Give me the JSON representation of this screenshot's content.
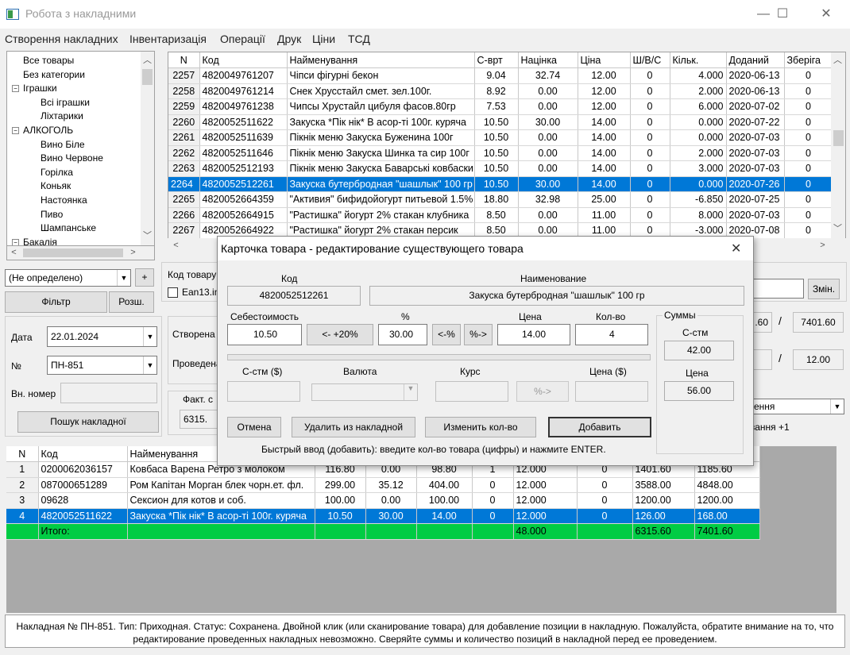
{
  "window": {
    "title": "Робота з накладними",
    "minimize": "—",
    "maximize": "☐",
    "close": "✕"
  },
  "menu": [
    "Створення накладних",
    "Інвентаризація",
    "Операції",
    "Друк",
    "Ціни",
    "ТСД"
  ],
  "tree": [
    {
      "label": "Все товары",
      "level": 0
    },
    {
      "label": "Без категории",
      "level": 0
    },
    {
      "label": "Іграшки",
      "level": 0,
      "expanded": true
    },
    {
      "label": "Всі іграшки",
      "level": 1
    },
    {
      "label": "Ліхтарики",
      "level": 1
    },
    {
      "label": "АЛКОГОЛЬ",
      "level": 0,
      "expanded": true
    },
    {
      "label": "Вино Біле",
      "level": 1
    },
    {
      "label": "Вино Червоне",
      "level": 1
    },
    {
      "label": "Горілка",
      "level": 1
    },
    {
      "label": "Коньяк",
      "level": 1
    },
    {
      "label": "Настоянка",
      "level": 1
    },
    {
      "label": "Пиво",
      "level": 1
    },
    {
      "label": "Шампанське",
      "level": 1
    },
    {
      "label": "Бакалія",
      "level": 0,
      "expanded": true
    }
  ],
  "left_panel": {
    "category_select": "(Не определено)",
    "plus": "+",
    "filter_btn": "Фільтр",
    "expand_btn": "Розш.",
    "date_label": "Дата",
    "date_value": "22.01.2024",
    "no_label": "№",
    "no_value": "ПН-851",
    "ext_no_label": "Вн. номер",
    "ext_no_value": "",
    "search_btn": "Пошук накладної"
  },
  "mid_panel": {
    "code_label": "Код товару",
    "ean_label": "Ean13.in",
    "created_label": "Створена",
    "posted_label": "Проведена",
    "fact_label": "Факт. с",
    "fact_value": "6315.",
    "sum_a": ".60",
    "sum_b": "7401.60",
    "sep1": "/",
    "price_a": "12.00",
    "sep2": "/",
    "change_btn": "Змін.",
    "right_combo": "ення",
    "right_label": "вання +1"
  },
  "products": {
    "columns": [
      "N",
      "Код",
      "Найменування",
      "С-врт",
      "Націнка",
      "Ціна",
      "Ш/В/С",
      "Кільк.",
      "Доданий",
      "Зберіга"
    ],
    "rows": [
      [
        "2257",
        "4820049761207",
        "Чіпси фігурні бекон",
        "9.04",
        "32.74",
        "12.00",
        "0",
        "4.000",
        "2020-06-13",
        "0"
      ],
      [
        "2258",
        "4820049761214",
        "Снек Хрусстайл смет. зел.100г.",
        "8.92",
        "0.00",
        "12.00",
        "0",
        "2.000",
        "2020-06-13",
        "0"
      ],
      [
        "2259",
        "4820049761238",
        "Чипсы Хрустайл цибуля фасов.80гр",
        "7.53",
        "0.00",
        "12.00",
        "0",
        "6.000",
        "2020-07-02",
        "0"
      ],
      [
        "2260",
        "4820052511622",
        "Закуска *Пік нік* В асор-ті 100г. куряча",
        "10.50",
        "30.00",
        "14.00",
        "0",
        "0.000",
        "2020-07-22",
        "0"
      ],
      [
        "2261",
        "4820052511639",
        "Пікнік меню Закуска Буженина 100г",
        "10.50",
        "0.00",
        "14.00",
        "0",
        "0.000",
        "2020-07-03",
        "0"
      ],
      [
        "2262",
        "4820052511646",
        "Пікнік меню Закуска Шинка та сир 100г",
        "10.50",
        "0.00",
        "14.00",
        "0",
        "2.000",
        "2020-07-03",
        "0"
      ],
      [
        "2263",
        "4820052512193",
        "Пікнік меню Закуска Баварські ковбаски",
        "10.50",
        "0.00",
        "14.00",
        "0",
        "3.000",
        "2020-07-03",
        "0"
      ],
      [
        "2264",
        "4820052512261",
        "Закуска бутербродная \"шашлык\" 100 гр",
        "10.50",
        "30.00",
        "14.00",
        "0",
        "0.000",
        "2020-07-26",
        "0"
      ],
      [
        "2265",
        "4820052664359",
        "\"Активия\" бифидойогурт питьевой 1.5%",
        "18.80",
        "32.98",
        "25.00",
        "0",
        "-6.850",
        "2020-07-25",
        "0"
      ],
      [
        "2266",
        "4820052664915",
        "\"Растишка\" йогурт 2%   стакан клубника",
        "8.50",
        "0.00",
        "11.00",
        "0",
        "8.000",
        "2020-07-03",
        "0"
      ],
      [
        "2267",
        "4820052664922",
        "\"Растишка\" йогурт 2%   стакан персик",
        "8.50",
        "0.00",
        "11.00",
        "0",
        "-3.000",
        "2020-07-08",
        "0"
      ]
    ],
    "selected_index": 7
  },
  "invoice": {
    "columns": [
      "N",
      "Код",
      "Найменування",
      "",
      "",
      "",
      "",
      "",
      "",
      "",
      ""
    ],
    "rows": [
      [
        "1",
        "0200062036157",
        "Ковбаса Варена Ретро з молоком",
        "116.80",
        "0.00",
        "98.80",
        "1",
        "12.000",
        "0",
        "1401.60",
        "1185.60"
      ],
      [
        "2",
        "087000651289",
        "Ром Капітан Морган блек чорн.ет. фл.",
        "299.00",
        "35.12",
        "404.00",
        "0",
        "12.000",
        "0",
        "3588.00",
        "4848.00"
      ],
      [
        "3",
        "09628",
        "Сексион для котов и соб.",
        "100.00",
        "0.00",
        "100.00",
        "0",
        "12.000",
        "0",
        "1200.00",
        "1200.00"
      ],
      [
        "4",
        "4820052511622",
        "Закуска *Пік нік* В асор-ті 100г. куряча",
        "10.50",
        "30.00",
        "14.00",
        "0",
        "12.000",
        "0",
        "126.00",
        "168.00"
      ]
    ],
    "total": [
      "",
      "Итого:",
      "",
      "",
      "",
      "",
      "",
      "48.000",
      "",
      "6315.60",
      "7401.60"
    ],
    "selected_index": 3
  },
  "dialog": {
    "title": "Карточка товара - редактирование существующего товара",
    "close": "✕",
    "code_label": "Код",
    "code_value": "4820052512261",
    "name_label": "Наименование",
    "name_value": "Закуска бутербродная \"шашлык\" 100 гр",
    "cost_label": "Себестоимость",
    "cost_value": "10.50",
    "plus20_btn": "<- +20%",
    "pct_label": "%",
    "pct_value": "30.00",
    "to_pct_btn": "<-%",
    "from_pct_btn": "%->",
    "price_label": "Цена",
    "price_value": "14.00",
    "qty_label": "Кол-во",
    "qty_value": "4",
    "sums_label": "Суммы",
    "sum_cost_label": "С-стм",
    "sum_cost_value": "42.00",
    "sum_price_label": "Цена",
    "sum_price_value": "56.00",
    "cost_usd_label": "С-стм ($)",
    "currency_label": "Валюта",
    "rate_label": "Курс",
    "pct_arrow_btn": "%->",
    "price_usd_label": "Цена ($)",
    "cancel_btn": "Отмена",
    "delete_btn": "Удалить из накладной",
    "change_qty_btn": "Изменить кол-во",
    "add_btn": "Добавить",
    "hint": "Быстрый ввод (добавить): введите кол-во товара (цифры) и нажмите ENTER."
  },
  "status": "Накладная № ПН-851. Тип: Приходная. Статус: Сохранена. Двойной клик (или сканирование товара) для добавление позиции в накладную. Пожалуйста, обратите внимание на то, что редактирование проведенных накладных невозможно. Сверяйте суммы и количество позиций в накладной перед ее проведением."
}
